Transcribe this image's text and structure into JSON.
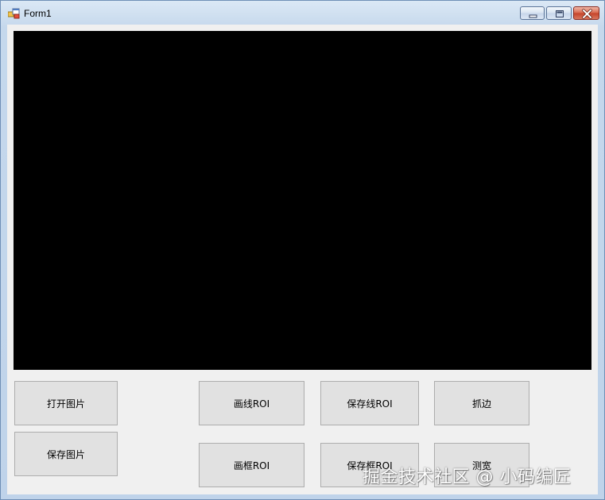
{
  "window": {
    "title": "Form1",
    "controls": {
      "minimize_icon": "minimize-icon",
      "maximize_icon": "maximize-icon",
      "close_icon": "close-icon"
    }
  },
  "buttons": {
    "open_image": "打开图片",
    "save_image": "保存图片",
    "draw_line_roi": "画线ROI",
    "save_line_roi": "保存线ROI",
    "edge_grab": "抓边",
    "draw_rect_roi": "画框ROI",
    "save_rect_roi": "保存框ROI",
    "measure_width": "测宽"
  },
  "watermark": "掘金技术社区 @ 小码编匠",
  "colors": {
    "picturebox": "#000000",
    "form_background": "#f0f0f0",
    "button_face": "#e1e1e1"
  }
}
